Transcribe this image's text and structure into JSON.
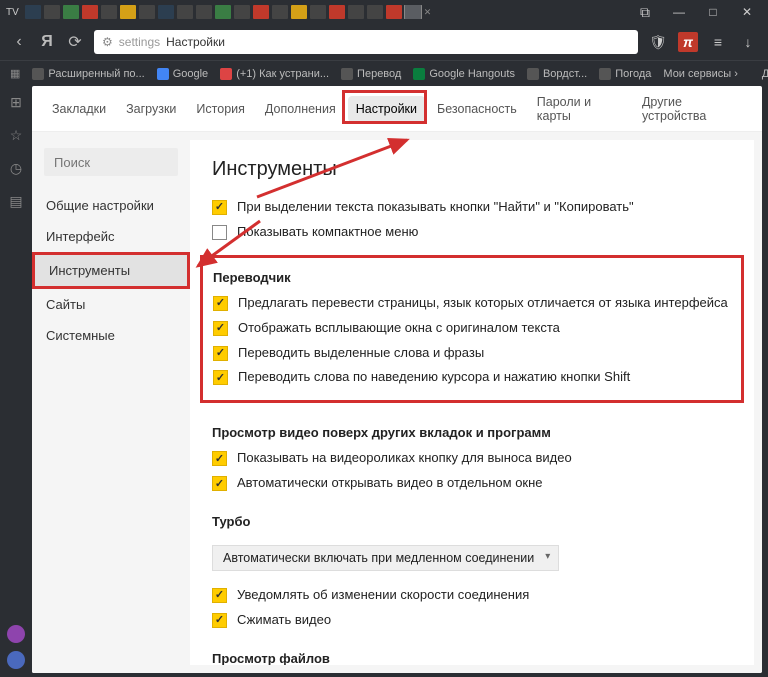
{
  "window": {
    "title_prefix": "TV",
    "min": "—",
    "max": "□",
    "restore": "❐",
    "close": "✕"
  },
  "nav": {
    "back": "‹",
    "ya": "Я",
    "reload": "⟳",
    "address_prefix": "settings",
    "address_text": "Настройки",
    "shield": "🛡",
    "ext": "π",
    "menu": "≡",
    "dl": "↓"
  },
  "bookmarks": {
    "items": [
      "Расширенный по...",
      "Google",
      "(+1) Как устрани...",
      "Перевод",
      "Google Hangouts",
      "Вордст...",
      "Погода",
      "Мои сервисы ›"
    ],
    "other": "Другие закладки"
  },
  "settings_tabs": {
    "items": [
      "Закладки",
      "Загрузки",
      "История",
      "Дополнения",
      "Настройки",
      "Безопасность",
      "Пароли и карты",
      "Другие устройства"
    ],
    "active_index": 4
  },
  "sidebar": {
    "search_placeholder": "Поиск",
    "items": [
      {
        "label": "Общие настройки"
      },
      {
        "label": "Интерфейс"
      },
      {
        "label": "Инструменты"
      },
      {
        "label": "Сайты"
      },
      {
        "label": "Системные"
      }
    ],
    "active_index": 2
  },
  "panel": {
    "title": "Инструменты",
    "top_options": [
      {
        "checked": true,
        "label": "При выделении текста показывать кнопки \"Найти\" и \"Копировать\""
      },
      {
        "checked": false,
        "label": "Показывать компактное меню"
      }
    ],
    "translator": {
      "title": "Переводчик",
      "options": [
        {
          "checked": true,
          "label": "Предлагать перевести страницы, язык которых отличается от языка интерфейса"
        },
        {
          "checked": true,
          "label": "Отображать всплывающие окна с оригиналом текста"
        },
        {
          "checked": true,
          "label": "Переводить выделенные слова и фразы"
        },
        {
          "checked": true,
          "label": "Переводить слова по наведению курсора и нажатию кнопки Shift"
        }
      ]
    },
    "video": {
      "title": "Просмотр видео поверх других вкладок и программ",
      "options": [
        {
          "checked": true,
          "label": "Показывать на видеороликах кнопку для выноса видео"
        },
        {
          "checked": true,
          "label": "Автоматически открывать видео в отдельном окне"
        }
      ]
    },
    "turbo": {
      "title": "Турбо",
      "dropdown": "Автоматически включать при медленном соединении",
      "options": [
        {
          "checked": true,
          "label": "Уведомлять об изменении скорости соединения"
        },
        {
          "checked": true,
          "label": "Сжимать видео"
        }
      ]
    },
    "files": {
      "title": "Просмотр файлов"
    }
  }
}
